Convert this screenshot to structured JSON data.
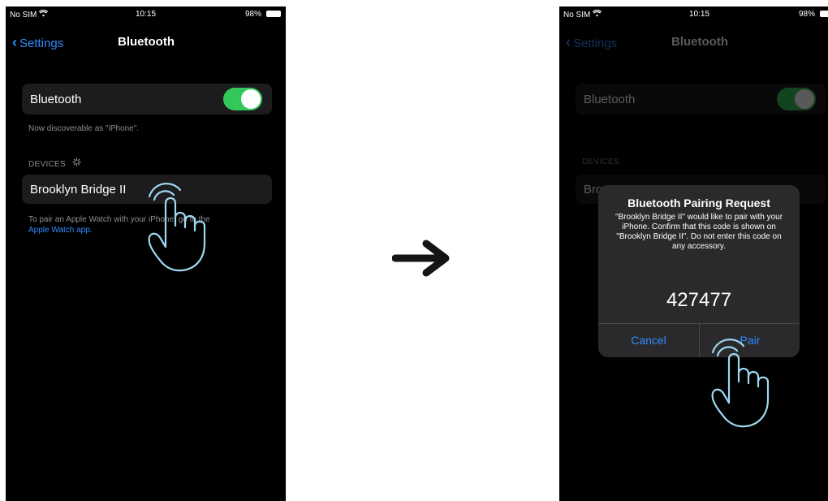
{
  "left": {
    "status": {
      "carrier": "No SIM",
      "time": "10:15",
      "battery": "98%"
    },
    "nav": {
      "back": "Settings",
      "title": "Bluetooth"
    },
    "bluetooth_row": {
      "label": "Bluetooth",
      "enabled": true
    },
    "discoverable_text": "Now discoverable as \"iPhone\".",
    "devices_header": "DEVICES",
    "device_name": "Brooklyn Bridge II",
    "watch_note_text": "To pair an Apple Watch with your iPhone, go to the",
    "watch_note_link": "Apple Watch app."
  },
  "right": {
    "status": {
      "carrier": "No SIM",
      "time": "10:15",
      "battery": "98%"
    },
    "nav": {
      "back": "Settings",
      "title": "Bluetooth"
    },
    "bluetooth_label": "Bluetooth",
    "devices_header": "DEVICES",
    "device_partial": "Bro",
    "alert": {
      "title": "Bluetooth Pairing Request",
      "message": "\"Brooklyn Bridge II\" would like to pair with your iPhone. Confirm that this code is shown on \"Brooklyn Bridge II\". Do not enter this code on any accessory.",
      "code": "427477",
      "cancel": "Cancel",
      "pair": "Pair"
    }
  },
  "colors": {
    "accent": "#2f8cff",
    "toggle_on": "#34c759",
    "background": "#000000",
    "cell": "#1c1c1e"
  },
  "icons": [
    "wifi-icon",
    "battery-icon",
    "chevron-left-icon",
    "spinner-icon",
    "tap-hand-icon",
    "arrow-right-icon"
  ]
}
